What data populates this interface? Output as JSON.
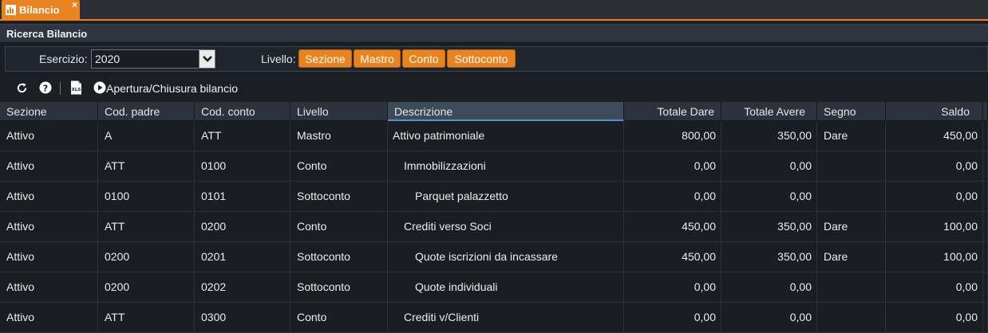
{
  "tab": {
    "title": "Bilancio",
    "close": "×"
  },
  "panel": {
    "title": "Ricerca Bilancio"
  },
  "search": {
    "esercizio_label": "Esercizio:",
    "esercizio_value": "2020",
    "livello_label": "Livello:",
    "levels": [
      "Sezione",
      "Mastro",
      "Conto",
      "Sottoconto"
    ]
  },
  "toolbar": {
    "refresh_icon": "refresh-icon",
    "help_icon": "help-icon",
    "xls_icon": "xls-export-icon",
    "play_icon": "play-circle-icon",
    "action_label": "Apertura/Chiusura bilancio"
  },
  "colors": {
    "accent": "#e8831f",
    "background": "#1a1e23",
    "header": "#2c333c"
  },
  "table": {
    "columns": [
      "Sezione",
      "Cod. padre",
      "Cod. conto",
      "Livello",
      "Descrizione",
      "Totale Dare",
      "Totale Avere",
      "Segno",
      "Saldo"
    ],
    "rows": [
      [
        "Attivo",
        "A",
        "ATT",
        "Mastro",
        "Attivo patrimoniale",
        "800,00",
        "350,00",
        "Dare",
        "450,00"
      ],
      [
        "Attivo",
        "ATT",
        "0100",
        "Conto",
        "Immobilizzazioni",
        "0,00",
        "0,00",
        "",
        "0,00"
      ],
      [
        "Attivo",
        "0100",
        "0101",
        "Sottoconto",
        "Parquet palazzetto",
        "0,00",
        "0,00",
        "",
        "0,00"
      ],
      [
        "Attivo",
        "ATT",
        "0200",
        "Conto",
        "Crediti verso Soci",
        "450,00",
        "350,00",
        "Dare",
        "100,00"
      ],
      [
        "Attivo",
        "0200",
        "0201",
        "Sottoconto",
        "Quote iscrizioni da incassare",
        "450,00",
        "350,00",
        "Dare",
        "100,00"
      ],
      [
        "Attivo",
        "0200",
        "0202",
        "Sottoconto",
        "Quote individuali",
        "0,00",
        "0,00",
        "",
        "0,00"
      ],
      [
        "Attivo",
        "ATT",
        "0300",
        "Conto",
        "Crediti v/Clienti",
        "0,00",
        "0,00",
        "",
        "0,00"
      ]
    ]
  }
}
